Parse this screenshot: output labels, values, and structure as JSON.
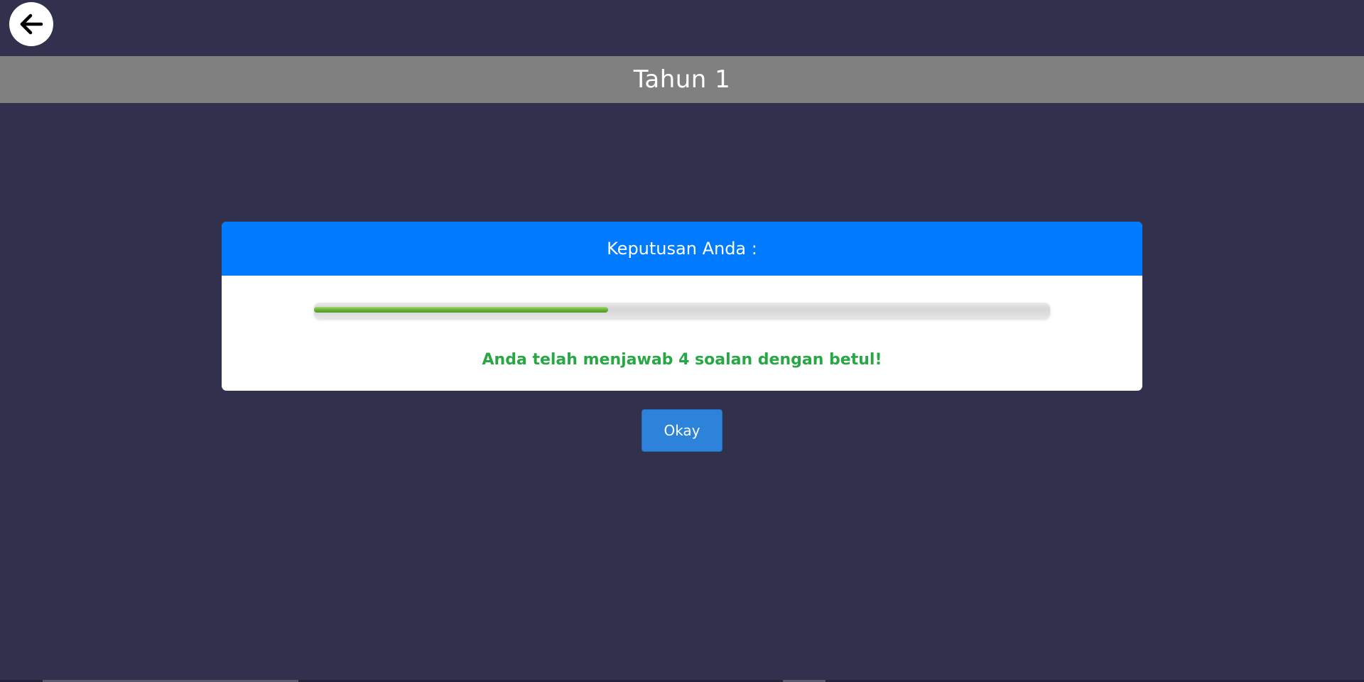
{
  "colors": {
    "background": "#31304d",
    "title_bar": "#808080",
    "card_header": "#007bff",
    "success_text": "#28a745",
    "okay_button": "#2c83d9",
    "progress_fill": "#6db33f"
  },
  "header": {
    "back_icon": "arrow-left-icon",
    "title": "Tahun 1"
  },
  "result_card": {
    "heading": "Keputusan Anda :",
    "progress_percent": 40,
    "message": "Anda telah menjawab 4 soalan dengan betul!"
  },
  "actions": {
    "okay_label": "Okay"
  }
}
